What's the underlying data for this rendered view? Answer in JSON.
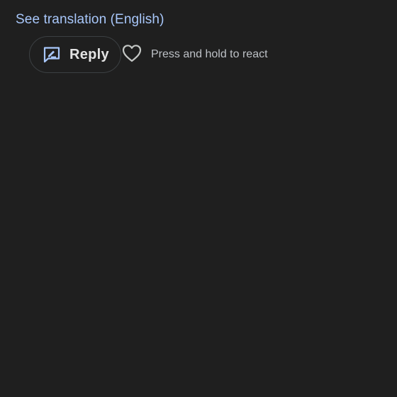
{
  "message": {
    "translation_link": "See translation (English)"
  },
  "actions": {
    "reply_label": "Reply",
    "react_hint": "Press and hold to react"
  },
  "icons": {
    "reply": "reply-bubble-icon",
    "react": "heart-outline-icon"
  },
  "colors": {
    "background": "#1f1f1f",
    "link": "#a8c7fa",
    "reply_icon": "#a8c7fa",
    "text_primary": "#e3e3e3",
    "text_secondary": "#bdc1c6",
    "button_border": "#3c4043"
  }
}
